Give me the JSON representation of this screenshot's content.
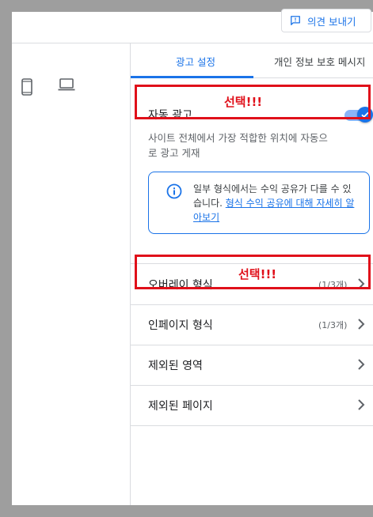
{
  "header": {
    "feedback_button": "의견 보내기"
  },
  "device_icons": [
    "mobile-icon",
    "laptop-icon"
  ],
  "tabs": [
    {
      "label": "광고 설정",
      "active": true
    },
    {
      "label": "개인 정보 보호 메시지",
      "active": false
    }
  ],
  "auto_ads": {
    "title": "자동 광고",
    "enabled": true,
    "description": "사이트 전체에서 가장 적합한 위치에 자동으로 광고 게재",
    "info_text": "일부 형식에서는 수익 공유가 다를 수 있습니다.",
    "info_link": "형식 수익 공유에 대해 자세히 알아보기"
  },
  "menu_items": [
    {
      "label": "오버레이 형식",
      "count": "(1/3개)"
    },
    {
      "label": "인페이지 형식",
      "count": "(1/3개)"
    },
    {
      "label": "제외된 영역",
      "count": ""
    },
    {
      "label": "제외된 페이지",
      "count": ""
    }
  ],
  "annotations": {
    "auto_ads_note": "선택!!!",
    "overlay_note": "선택!!!"
  },
  "colors": {
    "accent": "#1a73e8",
    "annotation": "#e0101a",
    "backdrop": "#9e9e9e"
  }
}
